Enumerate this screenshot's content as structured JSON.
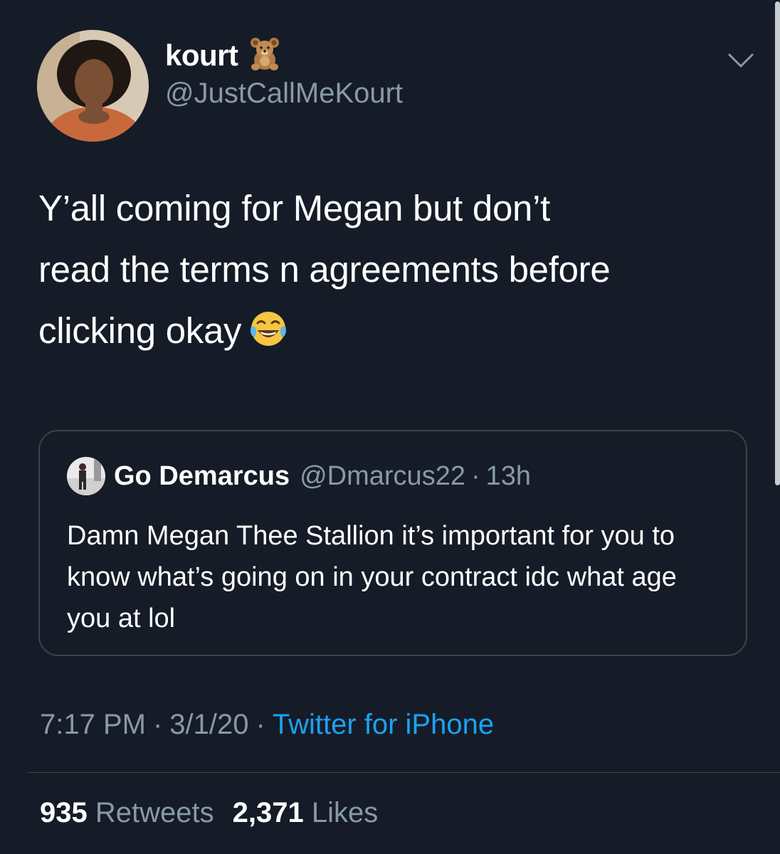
{
  "author": {
    "display_name": "kourt",
    "name_emoji": "bear-emoji",
    "handle": "@JustCallMeKourt"
  },
  "tweet": {
    "text_line1": "Y’all coming for Megan but don’t",
    "text_line2": "read the terms n agreements before",
    "text_line3": "clicking okay",
    "trailing_emoji": "tears-of-joy-emoji"
  },
  "quoted_tweet": {
    "display_name": "Go Demarcus",
    "handle": "@Dmarcus22",
    "separator": "·",
    "time": "13h",
    "text": "Damn Megan Thee Stallion it’s important for you to know what’s going on in your contract idc what age you at lol"
  },
  "meta": {
    "time": "7:17 PM",
    "date": "3/1/20",
    "separator": "·",
    "source": "Twitter for iPhone"
  },
  "stats": {
    "retweets_count": "935",
    "retweets_label": "Retweets",
    "likes_count": "2,371",
    "likes_label": "Likes"
  },
  "colors": {
    "background": "#151c27",
    "secondary_text": "#8899a6",
    "link": "#1da1f2",
    "border": "#38444d"
  }
}
